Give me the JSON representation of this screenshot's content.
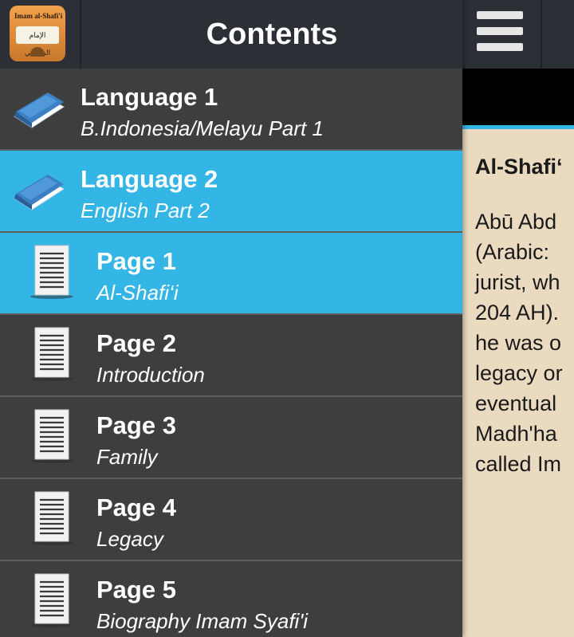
{
  "drawer": {
    "title": "Contents",
    "app_icon": {
      "name": "app-logo",
      "caption": "Imam al-Shafi'i",
      "arabic": "الإمام الشافعي"
    },
    "items": [
      {
        "type": "language",
        "title": "Language 1",
        "subtitle": "B.Indonesia/Melayu Part 1",
        "active": false,
        "icon": "book-icon"
      },
      {
        "type": "language",
        "title": "Language 2",
        "subtitle": "English Part 2",
        "active": true,
        "icon": "book-icon"
      },
      {
        "type": "page",
        "title": "Page 1",
        "subtitle": "Al-Shafi‘i",
        "active": true,
        "icon": "document-icon"
      },
      {
        "type": "page",
        "title": "Page 2",
        "subtitle": "Introduction",
        "active": false,
        "icon": "document-icon"
      },
      {
        "type": "page",
        "title": "Page 3",
        "subtitle": "Family",
        "active": false,
        "icon": "document-icon"
      },
      {
        "type": "page",
        "title": "Page 4",
        "subtitle": "Legacy",
        "active": false,
        "icon": "document-icon"
      },
      {
        "type": "page",
        "title": "Page 5",
        "subtitle": "Biography Imam Syafi'i",
        "active": false,
        "icon": "document-icon"
      }
    ]
  },
  "content": {
    "menu_icon": "hamburger-menu-icon",
    "article_title": "Al-Shafi‘",
    "article_lines": [
      "Abū  Abd",
      "(Arabic: ",
      "jurist, wh",
      "204 AH).",
      "he was o",
      "legacy or",
      "eventual",
      "Madh'ha",
      "called Im"
    ]
  },
  "colors": {
    "accent": "#33b5e5",
    "drawer_bg": "#3e3e3e",
    "header_bg": "#2c3036",
    "paper": "#eadbc0"
  }
}
